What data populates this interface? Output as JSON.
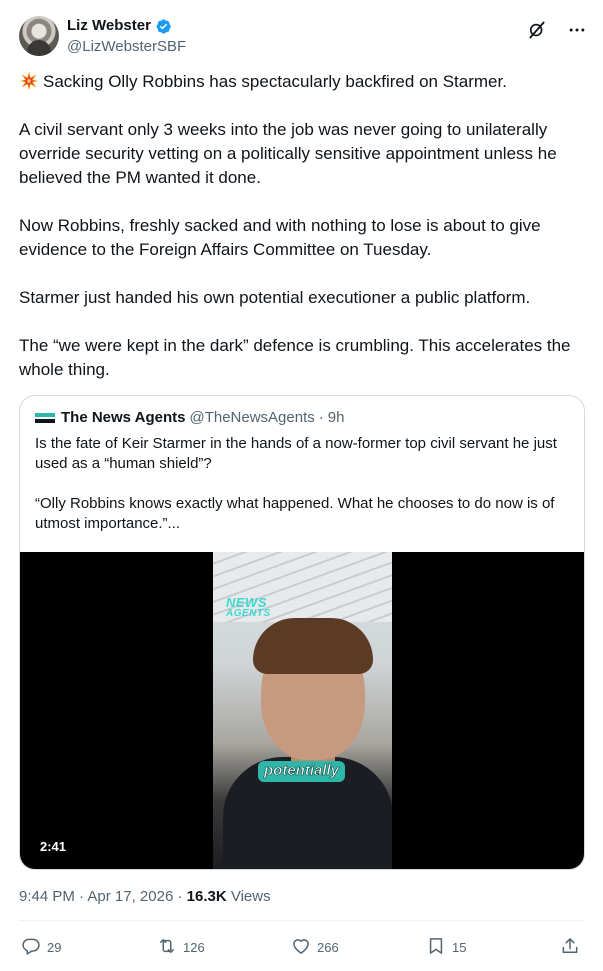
{
  "author": {
    "display_name": "Liz Webster",
    "handle": "@LizWebsterSBF",
    "verified": true
  },
  "tweet": {
    "emoji": "collision-burst",
    "paragraphs": [
      "Sacking Olly Robbins has spectacularly backfired on Starmer.",
      "A civil servant only 3 weeks into the job was never going to unilaterally override security vetting on a politically sensitive appointment unless he believed the PM wanted it done.",
      "Now Robbins, freshly sacked and with nothing to lose is about to give evidence to the Foreign Affairs Committee on Tuesday.",
      "Starmer just handed his own potential executioner a public platform.",
      "The “we were kept in the dark” defence is crumbling. This accelerates the whole thing."
    ]
  },
  "quote": {
    "name": "The News Agents",
    "handle": "@TheNewsAgents",
    "separator": "·",
    "age": "9h",
    "paragraphs": [
      "Is the fate of Keir Starmer in the hands of a now-former top civil servant he just used as a “human shield”?",
      "“Olly Robbins knows exactly what happened. What he chooses to do now is of utmost importance.”..."
    ],
    "video": {
      "logo_text_1": "NEWS",
      "logo_text_2": "AGENTS",
      "caption": "potentially",
      "duration": "2:41"
    }
  },
  "meta": {
    "time": "9:44 PM",
    "dot1": "·",
    "date": "Apr 17, 2026",
    "dot2": "·",
    "views_count": "16.3K",
    "views_label": "Views"
  },
  "actions": {
    "replies": "29",
    "reposts": "126",
    "likes": "266",
    "bookmarks": "15"
  },
  "colors": {
    "verified": "#1d9bf0",
    "secondary_text": "#536471",
    "border": "#cfd9de"
  },
  "icons": [
    "verified-badge-icon",
    "grok-icon",
    "more-icon",
    "collision-icon",
    "reply-icon",
    "repost-icon",
    "like-icon",
    "bookmark-icon",
    "share-icon"
  ]
}
